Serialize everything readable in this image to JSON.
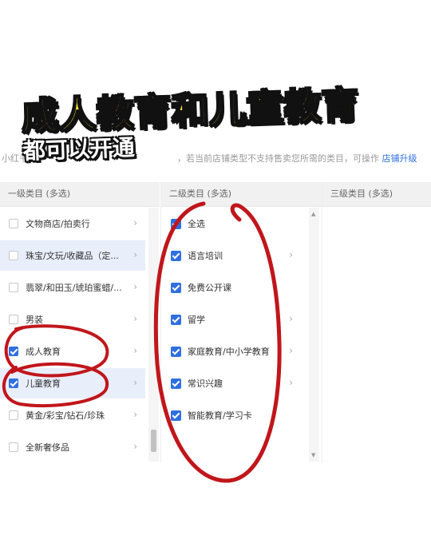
{
  "overlay": {
    "title": "成人教育和儿童教育",
    "subtitle": "都可以开通",
    "colors": {
      "title": "#f9e633",
      "outline": "#111111",
      "annotation": "#c0161b"
    }
  },
  "notice": {
    "prefix": "小红书",
    "text": "，若当前店铺类型不支持售卖您所需的类目，可操作",
    "link": "店铺升级"
  },
  "columns": {
    "level1": "一级类目 (多选)",
    "level2": "二级类目 (多选)",
    "level3": "三级类目 (多选)"
  },
  "level1_items": [
    {
      "label": "文物商店/拍卖行",
      "checked": false
    },
    {
      "label": "珠宝/文玩/收藏品（定...",
      "checked": false
    },
    {
      "label": "翡翠/和田玉/琥珀蜜蜡/...",
      "checked": false
    },
    {
      "label": "男装",
      "checked": false
    },
    {
      "label": "成人教育",
      "checked": true
    },
    {
      "label": "儿童教育",
      "checked": true
    },
    {
      "label": "黄金/彩宝/钻石/珍珠",
      "checked": false
    },
    {
      "label": "全新奢侈品",
      "checked": false
    }
  ],
  "level2_items": [
    {
      "label": "全选",
      "checked": true
    },
    {
      "label": "语言培训",
      "checked": true
    },
    {
      "label": "免费公开课",
      "checked": true
    },
    {
      "label": "留学",
      "checked": true
    },
    {
      "label": "家庭教育/中小学教育",
      "checked": true
    },
    {
      "label": "常识兴趣",
      "checked": true
    },
    {
      "label": "智能教育/学习卡",
      "checked": true
    }
  ],
  "icons": {
    "chevron": "chevron-right-icon",
    "check": "checkbox-checked-icon"
  }
}
